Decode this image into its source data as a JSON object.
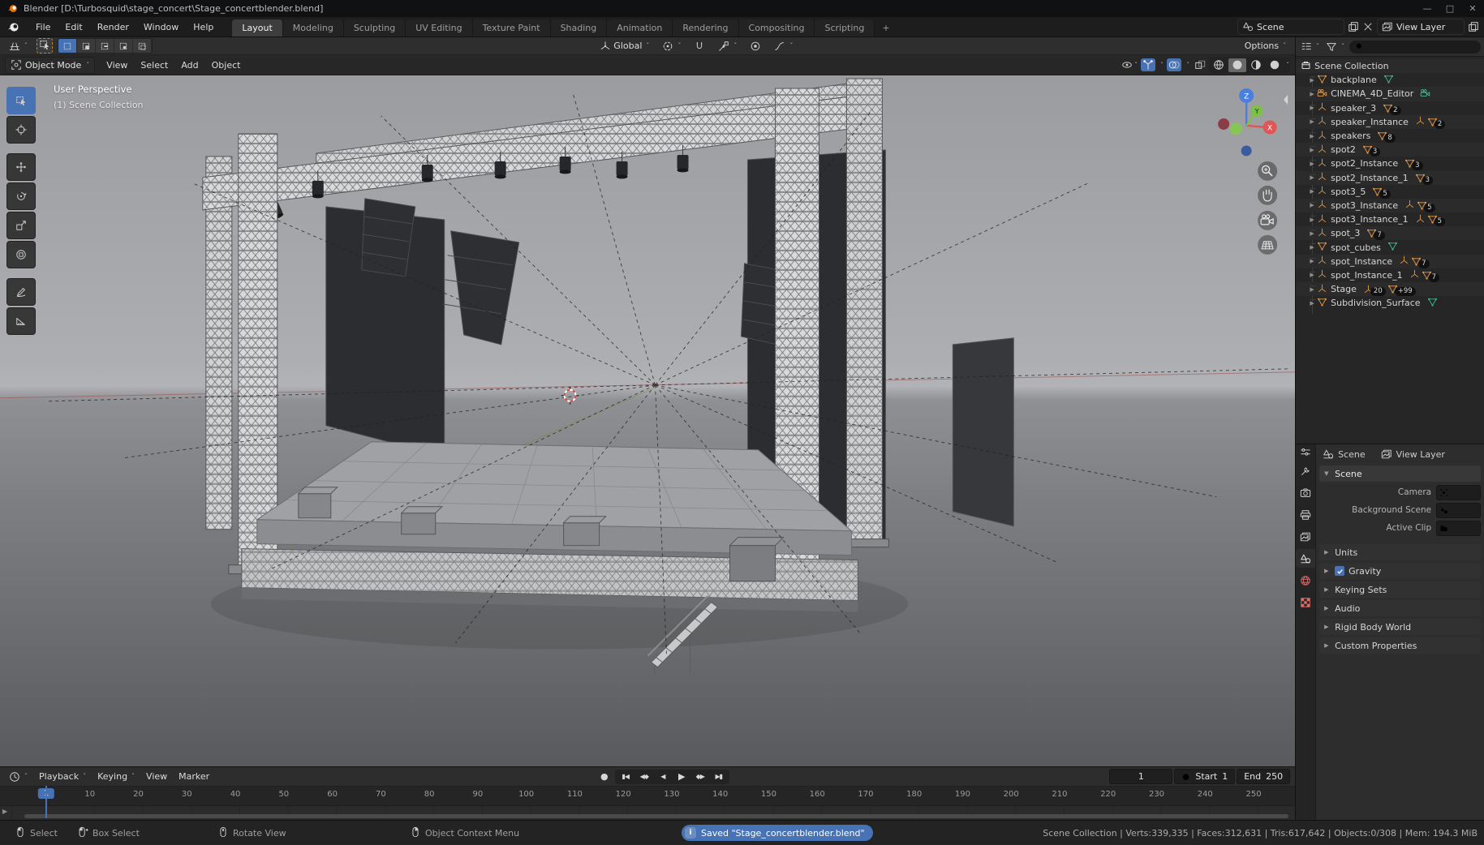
{
  "window": {
    "title": "Blender [D:\\Turbosquid\\stage_concert\\Stage_concertblender.blend]",
    "controls": [
      "minimize",
      "maximize",
      "close"
    ]
  },
  "topbar": {
    "menus": [
      "File",
      "Edit",
      "Render",
      "Window",
      "Help"
    ],
    "workspaces": [
      "Layout",
      "Modeling",
      "Sculpting",
      "UV Editing",
      "Texture Paint",
      "Shading",
      "Animation",
      "Rendering",
      "Compositing",
      "Scripting"
    ],
    "active_workspace": "Layout",
    "add_workspace_label": "+",
    "scene": {
      "label": "Scene"
    },
    "view_layer": {
      "label": "View Layer"
    }
  },
  "viewport": {
    "header": {
      "mode_label": "Object Mode",
      "menus": [
        "View",
        "Select",
        "Add",
        "Object"
      ],
      "orientation": "Global",
      "options_label": "Options",
      "select_modes": [
        "set",
        "extend",
        "subtract",
        "invert",
        "intersect"
      ],
      "shading_modes": [
        "wireframe",
        "solid",
        "material-preview",
        "rendered"
      ],
      "active_shading": "solid"
    },
    "overlay": {
      "line1": "User Perspective",
      "line2": "(1) Scene Collection"
    },
    "toolbar": [
      "select-box",
      "cursor",
      "move",
      "rotate",
      "scale",
      "transform",
      "annotate",
      "measure"
    ],
    "active_tool": "select-box",
    "gizmo_axes": {
      "x": "X",
      "y": "Y",
      "z": "Z"
    },
    "nav_buttons": [
      "zoom",
      "pan",
      "camera-view",
      "toggle-ortho"
    ]
  },
  "outliner": {
    "root": {
      "name": "Scene Collection"
    },
    "search_placeholder": "",
    "items": [
      {
        "name": "backplane",
        "icon": "mesh",
        "trailing": [
          {
            "t": "mesh-data"
          }
        ]
      },
      {
        "name": "CINEMA_4D_Editor",
        "icon": "camera",
        "trailing": [
          {
            "t": "camera-data"
          }
        ]
      },
      {
        "name": "speaker_3",
        "icon": "empty",
        "trailing": [
          {
            "t": "mesh-badge",
            "count": "2"
          }
        ]
      },
      {
        "name": "speaker_Instance",
        "icon": "empty",
        "trailing": [
          {
            "t": "empty-icon"
          },
          {
            "t": "mesh-badge",
            "count": "2"
          }
        ]
      },
      {
        "name": "speakers",
        "icon": "empty",
        "trailing": [
          {
            "t": "mesh-badge",
            "count": "8"
          }
        ]
      },
      {
        "name": "spot2",
        "icon": "empty",
        "trailing": [
          {
            "t": "mesh-badge",
            "count": "3"
          }
        ]
      },
      {
        "name": "spot2_Instance",
        "icon": "empty",
        "trailing": [
          {
            "t": "mesh-badge",
            "count": "3"
          }
        ]
      },
      {
        "name": "spot2_Instance_1",
        "icon": "empty",
        "trailing": [
          {
            "t": "mesh-badge",
            "count": "3"
          }
        ]
      },
      {
        "name": "spot3_5",
        "icon": "empty",
        "trailing": [
          {
            "t": "mesh-badge",
            "count": "5"
          }
        ]
      },
      {
        "name": "spot3_Instance",
        "icon": "empty",
        "trailing": [
          {
            "t": "empty-icon"
          },
          {
            "t": "mesh-badge",
            "count": "5"
          }
        ]
      },
      {
        "name": "spot3_Instance_1",
        "icon": "empty",
        "trailing": [
          {
            "t": "empty-icon"
          },
          {
            "t": "mesh-badge",
            "count": "5"
          }
        ]
      },
      {
        "name": "spot_3",
        "icon": "empty",
        "trailing": [
          {
            "t": "mesh-badge",
            "count": "7"
          }
        ]
      },
      {
        "name": "spot_cubes",
        "icon": "mesh",
        "trailing": [
          {
            "t": "mesh-data"
          }
        ]
      },
      {
        "name": "spot_Instance",
        "icon": "empty",
        "trailing": [
          {
            "t": "empty-icon"
          },
          {
            "t": "mesh-badge",
            "count": "7"
          }
        ]
      },
      {
        "name": "spot_Instance_1",
        "icon": "empty",
        "trailing": [
          {
            "t": "empty-icon"
          },
          {
            "t": "mesh-badge",
            "count": "7"
          }
        ]
      },
      {
        "name": "Stage",
        "icon": "empty",
        "trailing": [
          {
            "t": "empty-badge",
            "count": "20"
          },
          {
            "t": "mesh-badge",
            "count": "+99"
          }
        ]
      },
      {
        "name": "Subdivision_Surface",
        "icon": "mesh",
        "trailing": [
          {
            "t": "mesh-data"
          }
        ]
      }
    ]
  },
  "properties": {
    "tabs": [
      "tool",
      "render",
      "output",
      "view-layer",
      "scene",
      "world",
      "texture"
    ],
    "active_tab": "scene",
    "breadcrumb": {
      "scene": "Scene",
      "view_layer": "View Layer"
    },
    "scene_panel": {
      "title": "Scene",
      "fields": [
        {
          "label": "Camera",
          "value": ""
        },
        {
          "label": "Background Scene",
          "value": ""
        },
        {
          "label": "Active Clip",
          "value": ""
        }
      ]
    },
    "collapsed_panels": [
      {
        "label": "Units"
      },
      {
        "label": "Gravity",
        "checkbox": true,
        "checked": true
      },
      {
        "label": "Keying Sets"
      },
      {
        "label": "Audio"
      },
      {
        "label": "Rigid Body World"
      },
      {
        "label": "Custom Properties"
      }
    ]
  },
  "timeline": {
    "menus": [
      "Playback",
      "Keying",
      "View",
      "Marker"
    ],
    "transport": [
      "jump-to-start",
      "jump-to-prev-keyframe",
      "play-reverse",
      "play",
      "jump-to-next-keyframe",
      "jump-to-end"
    ],
    "current_frame": "1",
    "start_label": "Start",
    "start_value": "1",
    "end_label": "End",
    "end_value": "250",
    "ticks": [
      1,
      10,
      20,
      30,
      40,
      50,
      60,
      70,
      80,
      90,
      100,
      110,
      120,
      130,
      140,
      150,
      160,
      170,
      180,
      190,
      200,
      210,
      220,
      230,
      240,
      250
    ]
  },
  "statusbar": {
    "hints": [
      {
        "icon": "mouse-left",
        "label": "Select"
      },
      {
        "icon": "mouse-drag",
        "label": "Box Select"
      },
      {
        "icon": "mouse-middle",
        "label": "Rotate View"
      },
      {
        "icon": "mouse-right",
        "label": "Object Context Menu"
      }
    ],
    "saved_message": "Saved \"Stage_concertblender.blend\"",
    "stats": "Scene Collection | Verts:339,335 | Faces:312,631 | Tris:617,642 | Objects:0/308 | Mem: 194.3 MiB"
  },
  "colors": {
    "accent": "#4772b3",
    "object_orange": "#e39b4b",
    "data_green": "#3fbf8f",
    "axis_x": "#e25f5f",
    "axis_y": "#7cbf4a",
    "axis_z": "#4a7fe0",
    "saved_pill": "#4772b3"
  }
}
